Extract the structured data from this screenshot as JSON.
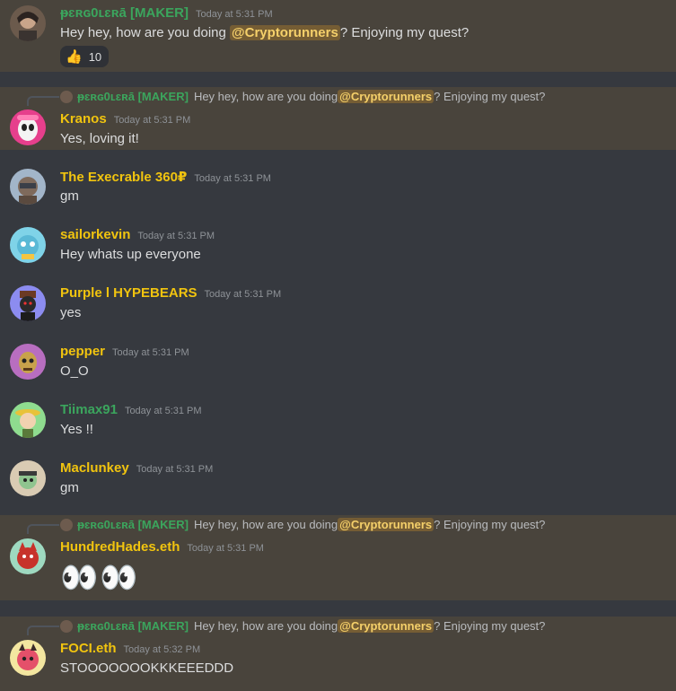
{
  "reply_preview": {
    "author": "ᵽɛʀɢ0ʟɛʀā [MAKER]",
    "text_before": "Hey hey, how are you doing ",
    "mention": "@Cryptorunners",
    "text_after": "? Enjoying my quest?"
  },
  "messages": [
    {
      "username": "ᵽɛʀɢ0ʟɛʀā [MAKER]",
      "color": "#3ba55d",
      "timestamp": "Today at 5:31 PM",
      "text_before": "Hey hey, how are you doing ",
      "mention": "@Cryptorunners",
      "text_after": "? Enjoying my quest?",
      "reaction": {
        "emoji": "👍",
        "count": "10"
      }
    },
    {
      "username": "Kranos",
      "color": "#f1c40f",
      "timestamp": "Today at 5:31 PM",
      "text": "Yes, loving it!"
    },
    {
      "username": "The Execrable 360₽",
      "color": "#f1c40f",
      "timestamp": "Today at 5:31 PM",
      "text": "gm"
    },
    {
      "username": "sailorkevin",
      "color": "#f1c40f",
      "timestamp": "Today at 5:31 PM",
      "text": "Hey whats up everyone"
    },
    {
      "username": "Purple l HYPEBEARS",
      "color": "#f1c40f",
      "timestamp": "Today at 5:31 PM",
      "text": "yes"
    },
    {
      "username": "pepper",
      "color": "#f1c40f",
      "timestamp": "Today at 5:31 PM",
      "text": "O_O"
    },
    {
      "username": "Tiimax91",
      "color": "#3ba55d",
      "timestamp": "Today at 5:31 PM",
      "text": "Yes !!"
    },
    {
      "username": "Maclunkey",
      "color": "#f1c40f",
      "timestamp": "Today at 5:31 PM",
      "text": "gm"
    },
    {
      "username": "HundredHades.eth",
      "color": "#f1c40f",
      "timestamp": "Today at 5:31 PM",
      "text": "👀"
    },
    {
      "username": "FOCI.eth",
      "color": "#f1c40f",
      "timestamp": "Today at 5:32 PM",
      "text": "STOOOOOOOKKKEEEDDD"
    }
  ],
  "avatar_icons": [
    "maker-avatar",
    "kranos-avatar",
    "execrable-avatar",
    "sailorkevin-avatar",
    "purple-avatar",
    "pepper-avatar",
    "tiimax-avatar",
    "maclunkey-avatar",
    "hundredhades-avatar",
    "foci-avatar"
  ]
}
